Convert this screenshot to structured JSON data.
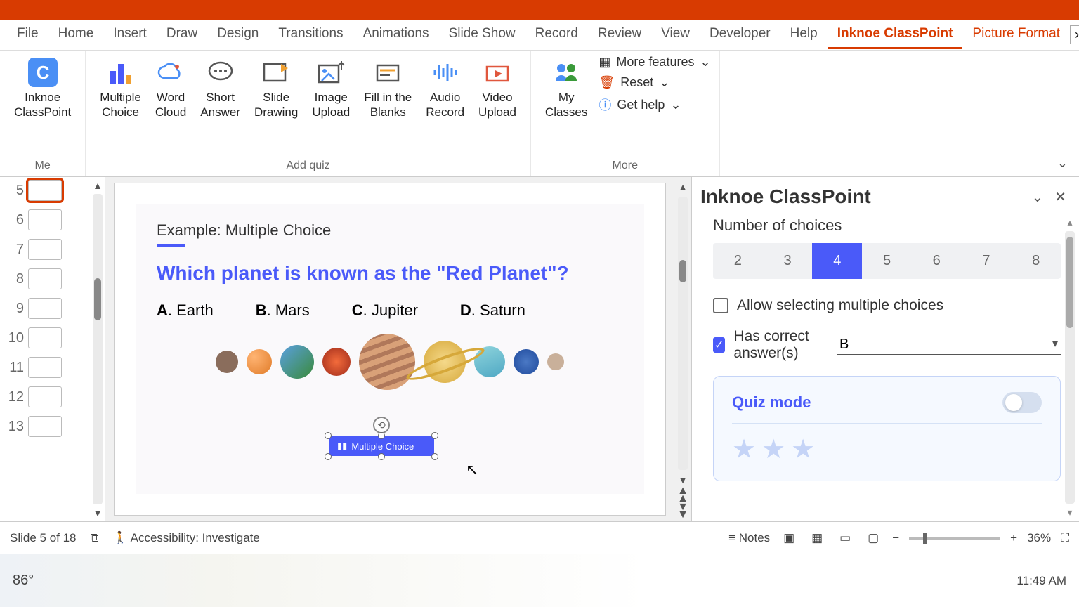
{
  "tabs": {
    "file": "File",
    "home": "Home",
    "insert": "Insert",
    "draw": "Draw",
    "design": "Design",
    "transitions": "Transitions",
    "animations": "Animations",
    "slideshow": "Slide Show",
    "record": "Record",
    "review": "Review",
    "view": "View",
    "developer": "Developer",
    "help": "Help",
    "classpoint": "Inknoe ClassPoint",
    "pictureformat": "Picture Format"
  },
  "ribbon": {
    "groups": {
      "me": "Me",
      "addquiz": "Add quiz",
      "more": "More"
    },
    "buttons": {
      "classpoint": "Inknoe\nClassPoint",
      "mc": "Multiple\nChoice",
      "wc": "Word\nCloud",
      "sa": "Short\nAnswer",
      "sd": "Slide\nDrawing",
      "iu": "Image\nUpload",
      "fb": "Fill in the\nBlanks",
      "ar": "Audio\nRecord",
      "vu": "Video\nUpload",
      "myclass": "My\nClasses"
    },
    "more": {
      "features": "More features",
      "reset": "Reset",
      "help": "Get help"
    }
  },
  "thumbs": [
    "5",
    "6",
    "7",
    "8",
    "9",
    "10",
    "11",
    "12",
    "13"
  ],
  "slide": {
    "example": "Example: Multiple Choice",
    "question": "Which planet is known as the \"Red Planet\"?",
    "a": "Earth",
    "b": "Mars",
    "c": "Jupiter",
    "d": "Saturn",
    "btn": "Multiple Choice"
  },
  "pane": {
    "title": "Inknoe ClassPoint",
    "numlabel": "Number of choices",
    "nums": [
      "2",
      "3",
      "4",
      "5",
      "6",
      "7",
      "8"
    ],
    "allow": "Allow selecting multiple choices",
    "hascorrect": "Has correct answer(s)",
    "answer": "B",
    "quizmode": "Quiz mode"
  },
  "status": {
    "slide": "Slide 5 of 18",
    "access": "Accessibility: Investigate",
    "notes": "Notes",
    "zoom": "36%"
  },
  "taskbar": {
    "temp": "86°",
    "time": "11:49 AM"
  }
}
